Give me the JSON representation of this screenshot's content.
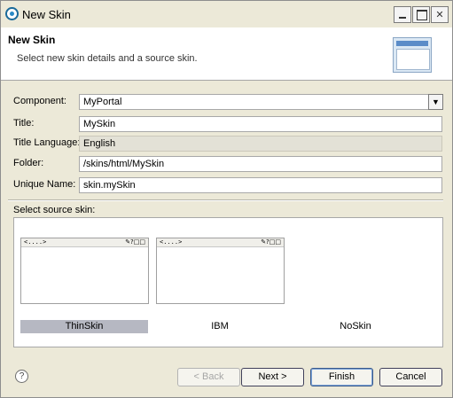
{
  "window": {
    "title": "New Skin"
  },
  "banner": {
    "title": "New Skin",
    "description": "Select new skin details and a source skin."
  },
  "form": {
    "component": {
      "label": "Component:",
      "value": "MyPortal"
    },
    "title": {
      "label": "Title:",
      "value": "MySkin"
    },
    "title_language": {
      "label": "Title Language:",
      "value": "English"
    },
    "folder": {
      "label": "Folder:",
      "value": "/skins/html/MySkin"
    },
    "unique_name": {
      "label": "Unique Name:",
      "value": "skin.mySkin"
    }
  },
  "source_skin": {
    "label": "Select source skin:",
    "preview_text": "<....>",
    "preview_controls": "✎?□□",
    "skins": [
      {
        "name": "ThinSkin",
        "selected": true
      },
      {
        "name": "IBM",
        "selected": false
      },
      {
        "name": "NoSkin",
        "selected": false
      }
    ]
  },
  "buttons": {
    "back": "< Back",
    "next": "Next >",
    "finish": "Finish",
    "cancel": "Cancel"
  },
  "colors": {
    "selection": "#b6b8c2",
    "dialog_bg": "#ece9d8"
  }
}
